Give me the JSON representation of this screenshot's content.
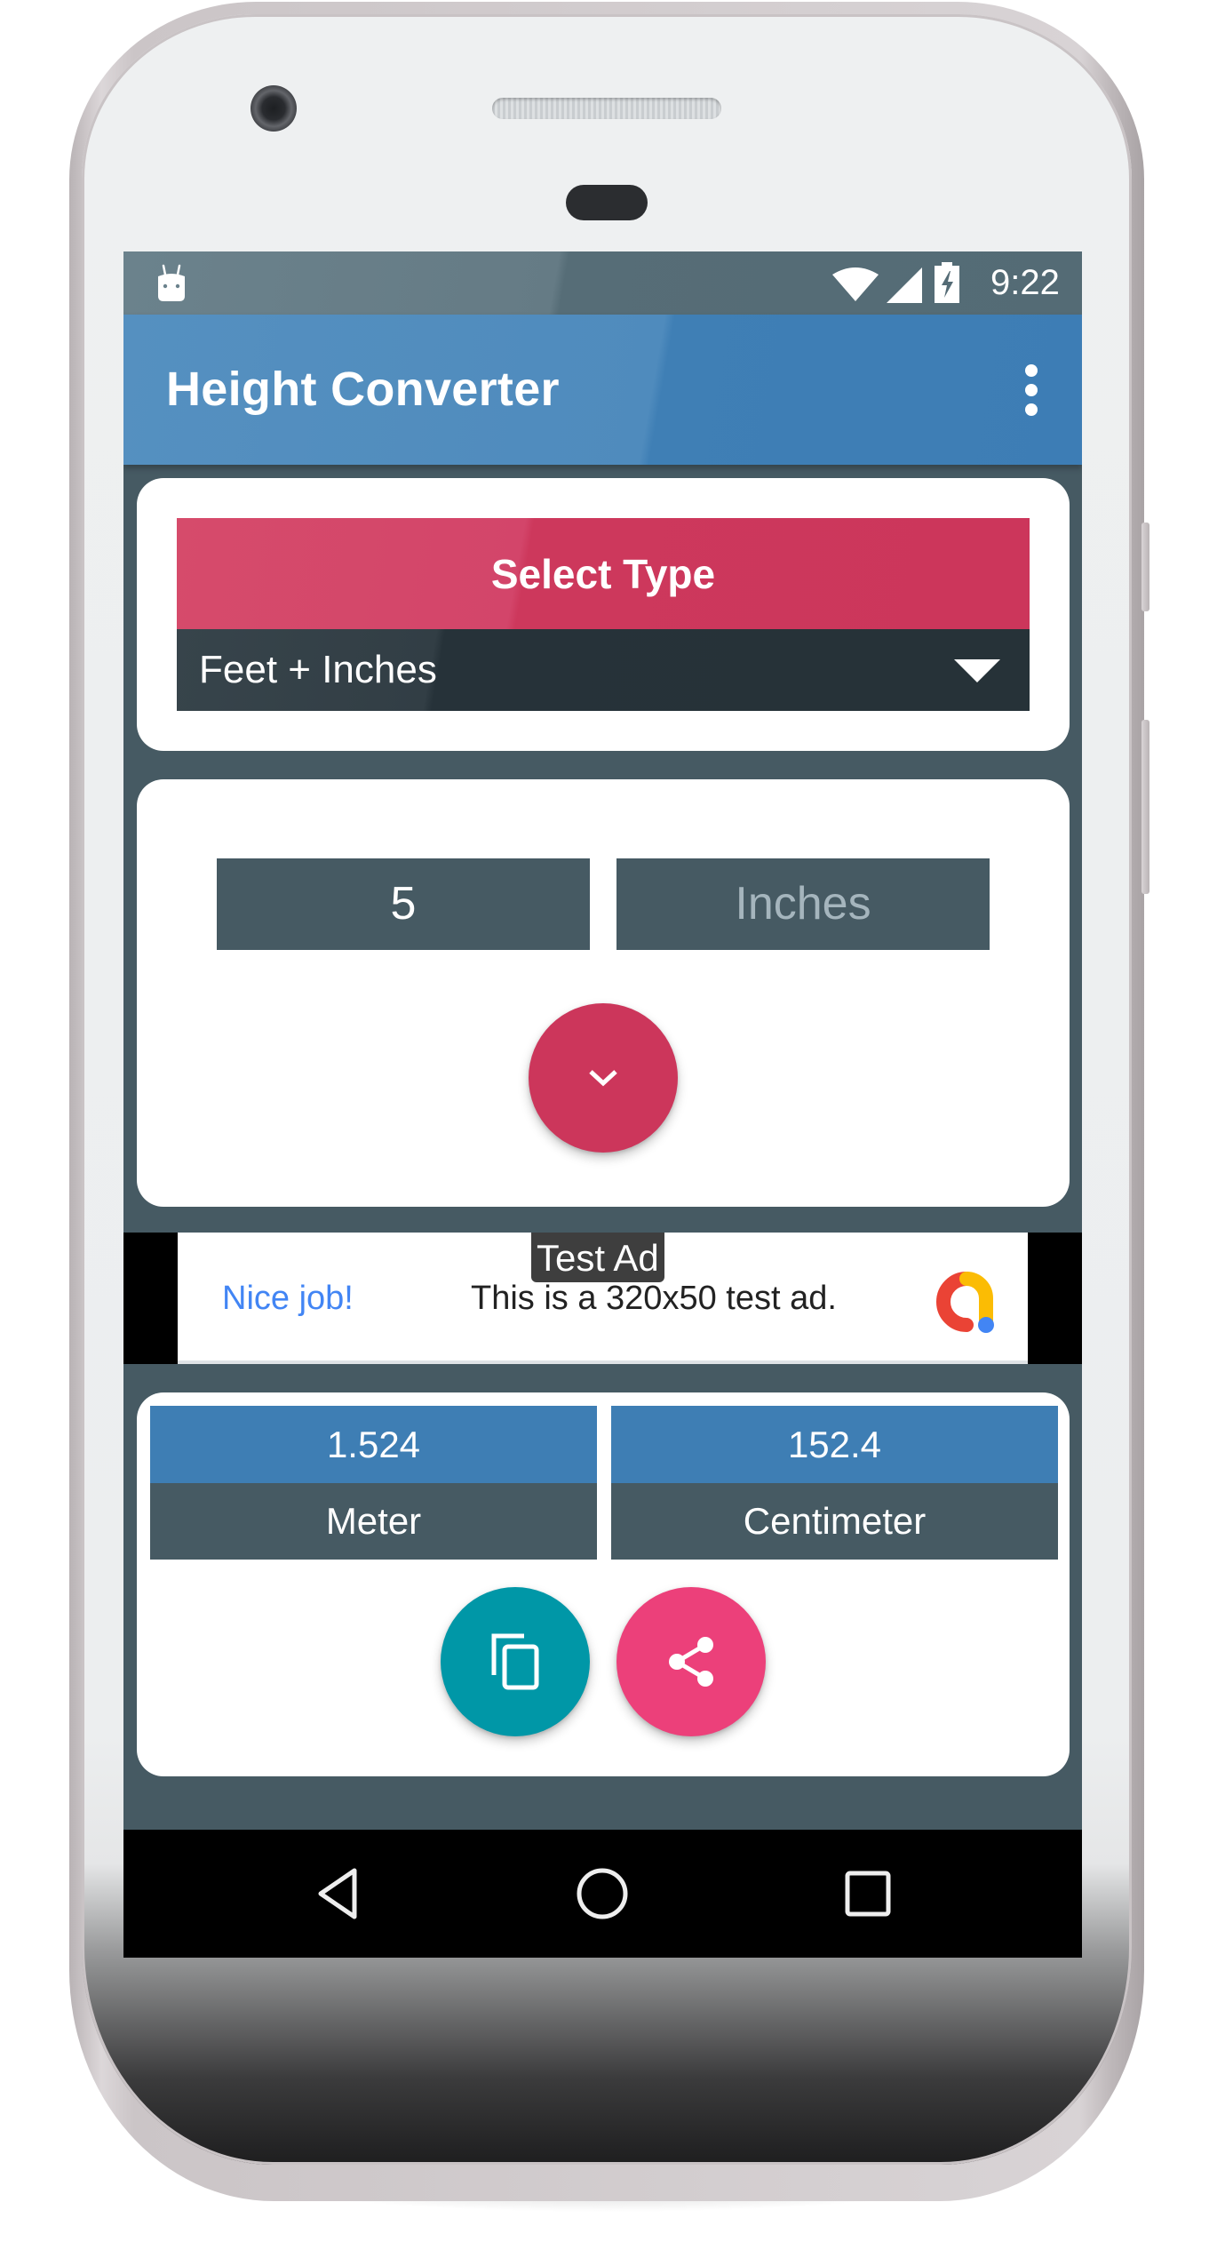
{
  "device": {
    "frame_color": "#d8d3d5",
    "face_color": "#eceeef"
  },
  "status_bar": {
    "notification_icon": "android-robot-icon",
    "icons": [
      "wifi-icon",
      "cellular-signal-icon",
      "battery-charging-icon"
    ],
    "time": "9:22"
  },
  "app_bar": {
    "title": "Height Converter",
    "menu_icon": "more-vert-icon",
    "color": "#3d7db5"
  },
  "type_selector": {
    "header_label": "Select Type",
    "selected_value": "Feet + Inches",
    "header_color": "#cc365b",
    "spinner_color": "#263238"
  },
  "inputs": {
    "feet": {
      "value": "5",
      "placeholder": ""
    },
    "inches": {
      "value": "",
      "placeholder": "Inches"
    },
    "convert_button_icon": "chevron-down-icon",
    "convert_button_color": "#cc365b"
  },
  "ad": {
    "label": "Test Ad",
    "headline": "Nice job!",
    "body": "This is a 320x50 test ad.",
    "logo": "admob-logo-icon"
  },
  "results": [
    {
      "value": "1.524",
      "unit": "Meter"
    },
    {
      "value": "152.4",
      "unit": "Centimeter"
    }
  ],
  "actions": {
    "copy_icon": "content-copy-icon",
    "copy_color": "#0097a7",
    "share_icon": "share-icon",
    "share_color": "#ec407a"
  },
  "nav_bar": {
    "back_icon": "back-triangle-icon",
    "home_icon": "home-circle-icon",
    "recents_icon": "recents-square-icon"
  }
}
